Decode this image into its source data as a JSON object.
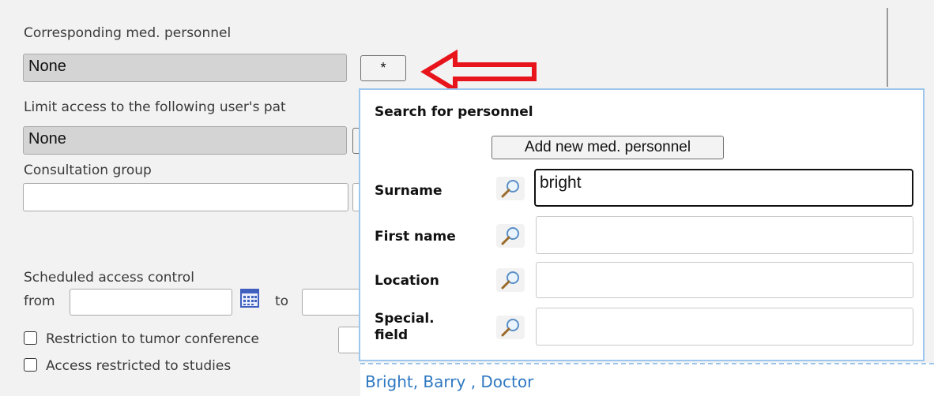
{
  "form": {
    "corresponding_label": "Corresponding med. personnel",
    "corresponding_value": "None",
    "select_button_label": "*",
    "limit_access_label": "Limit access to the following user's pat",
    "limit_access_value": "None",
    "consultation_label": "Consultation group",
    "consultation_value": "",
    "scheduled_label": "Scheduled access control",
    "from_label": "from",
    "to_label": "to",
    "restriction_label": "Restriction to tumor conference",
    "access_studies_label": "Access restricted to studies"
  },
  "popup": {
    "title": "Search for personnel",
    "add_button_label": "Add new med. personnel",
    "fields": [
      {
        "label": "Surname",
        "value": "bright"
      },
      {
        "label": "First name",
        "value": ""
      },
      {
        "label": "Location",
        "value": ""
      },
      {
        "label_line1": "Special.",
        "label_line2": "field",
        "value": ""
      }
    ]
  },
  "results": [
    "Bright, Barry , Doctor"
  ],
  "colors": {
    "arrow": "#e8141c",
    "popup_border": "#9cc6ee",
    "result_link": "#2e78c2"
  }
}
